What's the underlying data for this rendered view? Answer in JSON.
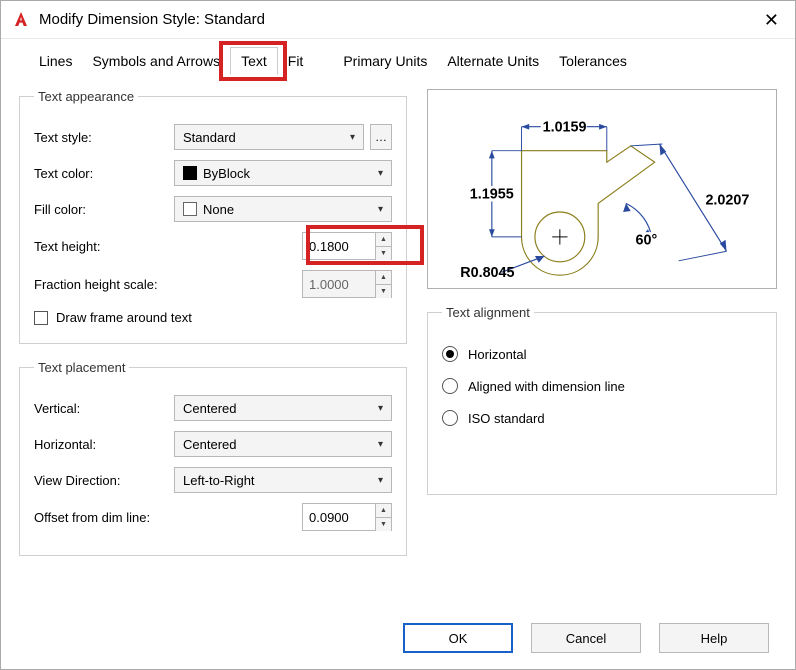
{
  "window": {
    "title_label": "Modify Dimension Style: Standard"
  },
  "tabs": {
    "lines": "Lines",
    "symbols": "Symbols and Arrows",
    "text": "Text",
    "fit": "Fit",
    "primary": "Primary Units",
    "alternate": "Alternate Units",
    "tolerances": "Tolerances"
  },
  "appearance": {
    "legend": "Text appearance",
    "text_style_label": "Text style:",
    "text_style_value": "Standard",
    "text_color_label": "Text color:",
    "text_color_value": "ByBlock",
    "fill_color_label": "Fill color:",
    "fill_color_value": "None",
    "text_height_label": "Text height:",
    "text_height_value": "0.1800",
    "fraction_scale_label": "Fraction height scale:",
    "fraction_scale_value": "1.0000",
    "frame_checkbox": "Draw frame around text"
  },
  "placement": {
    "legend": "Text placement",
    "vertical_label": "Vertical:",
    "vertical_value": "Centered",
    "horizontal_label": "Horizontal:",
    "horizontal_value": "Centered",
    "direction_label": "View Direction:",
    "direction_value": "Left-to-Right",
    "offset_label": "Offset from dim line:",
    "offset_value": "0.0900"
  },
  "alignment": {
    "legend": "Text alignment",
    "horizontal": "Horizontal",
    "aligned": "Aligned with dimension line",
    "iso": "ISO standard"
  },
  "preview": {
    "dim_top": "1.0159",
    "dim_left": "1.1955",
    "dim_right": "2.0207",
    "dim_angle": "60°",
    "dim_radius": "R0.8045"
  },
  "buttons": {
    "ok": "OK",
    "cancel": "Cancel",
    "help": "Help"
  },
  "glyphs": {
    "chevron_down": "▾",
    "spin_up": "▲",
    "spin_down": "▼",
    "ellipsis": "…"
  }
}
